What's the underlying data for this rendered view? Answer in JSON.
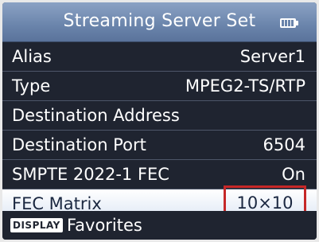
{
  "header": {
    "title": "Streaming Server Set",
    "battery_icon": "battery-icon"
  },
  "menu": {
    "items": [
      {
        "label": "Alias",
        "value": "Server1"
      },
      {
        "label": "Type",
        "value": "MPEG2-TS/RTP"
      },
      {
        "label": "Destination Address",
        "value": ""
      },
      {
        "label": "Destination Port",
        "value": "6504"
      },
      {
        "label": "SMPTE 2022-1 FEC",
        "value": "On"
      },
      {
        "label": "FEC Matrix",
        "value": "10×10"
      }
    ]
  },
  "footer": {
    "display_key": "DISPLAY",
    "label": "Favorites"
  },
  "colors": {
    "highlight_border": "#c62828",
    "title_bar": "#6a84ab",
    "background": "#1f2430"
  }
}
